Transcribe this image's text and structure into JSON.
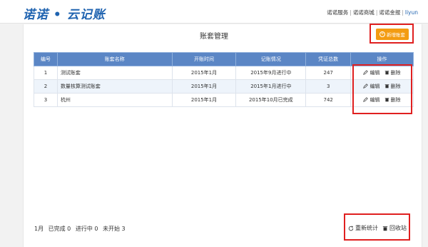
{
  "header": {
    "logo": "诺诺 • 云记账",
    "nav": [
      "诺诺服务",
      "诺诺商城",
      "诺诺金报",
      "liyun"
    ]
  },
  "page": {
    "title": "账套管理",
    "add_button": "新增账套"
  },
  "table": {
    "columns": [
      "编号",
      "账套名称",
      "开账时间",
      "记账情况",
      "凭证总数",
      "操作"
    ],
    "rows": [
      {
        "id": "1",
        "name": "测试账套",
        "open_time": "2015年1月",
        "status": "2015年9月进行中",
        "vouchers": "247",
        "edit": "编辑",
        "delete": "删除"
      },
      {
        "id": "2",
        "name": "数量核算测试账套",
        "open_time": "2015年1月",
        "status": "2015年1月进行中",
        "vouchers": "3",
        "edit": "编辑",
        "delete": "删除"
      },
      {
        "id": "3",
        "name": "杭州",
        "open_time": "2015年1月",
        "status": "2015年10月已完成",
        "vouchers": "742",
        "edit": "编辑",
        "delete": "删除"
      }
    ]
  },
  "footer": {
    "month": "1月",
    "completed": "已完成 0",
    "in_progress": "进行中 0",
    "not_started": "未开始 3",
    "recount": "重新统计",
    "recycle": "回收站"
  },
  "colors": {
    "brand": "#1f63b0",
    "header_row": "#5b86c5",
    "add_button": "#f39c12",
    "highlight": "#e02020"
  },
  "icons": [
    "edit-icon",
    "trash-icon",
    "refresh-icon",
    "plus-circle-icon"
  ]
}
